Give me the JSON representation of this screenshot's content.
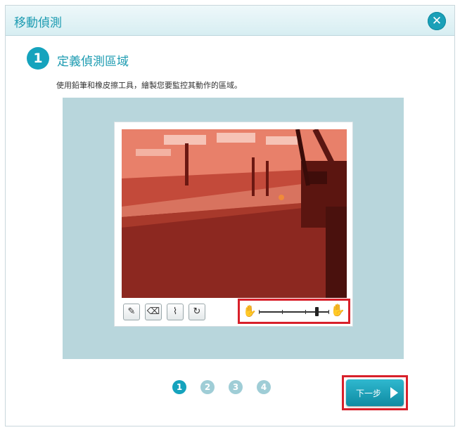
{
  "dialog": {
    "title": "移動偵測",
    "close_icon": "close-icon",
    "step": {
      "number": "1",
      "title": "定義偵測區域",
      "instruction": "使用鉛筆和橡皮擦工具，繪製您要監控其動作的區域。"
    },
    "tools": [
      {
        "name": "pencil-icon",
        "glyph": "✎"
      },
      {
        "name": "eraser-icon",
        "glyph": "⌫"
      },
      {
        "name": "broom-icon",
        "glyph": "⌇"
      },
      {
        "name": "refresh-icon",
        "glyph": "↻"
      }
    ],
    "sensitivity": {
      "low_icon": "hand-low-icon",
      "high_icon": "hand-high-icon",
      "level": 0.82
    },
    "pager": [
      "1",
      "2",
      "3",
      "4"
    ],
    "active_page": "1",
    "next_label": "下一步",
    "colors": {
      "accent": "#15a3bd",
      "overlay": "#e0483c",
      "highlight": "#d8202a"
    }
  }
}
